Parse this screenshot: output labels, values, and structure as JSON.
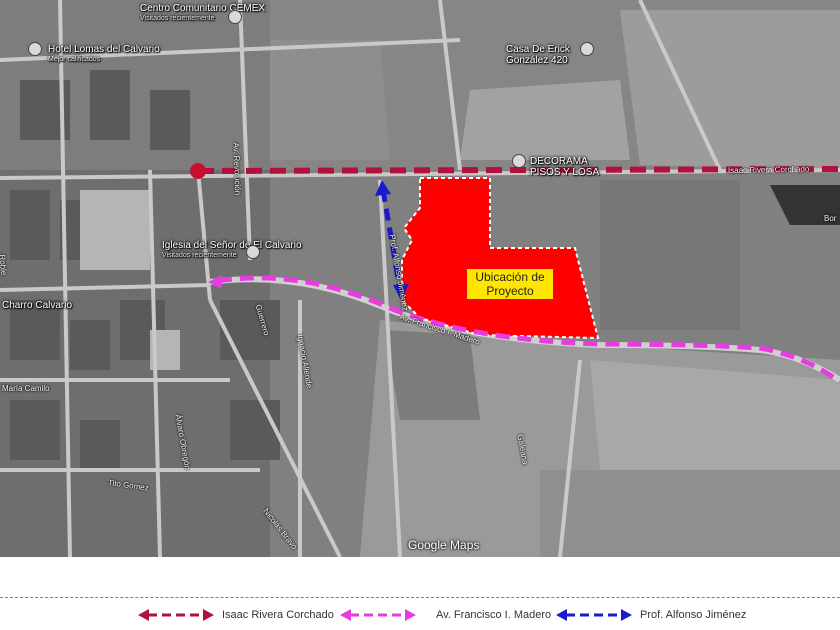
{
  "map": {
    "attribution": "Google Maps",
    "project_label": "Ubicación de Proyecto",
    "pois": [
      {
        "name": "Centro Comunitario CEMEX",
        "sub": "Visitados recientemente"
      },
      {
        "name": "Hotel Lomas del Calvario",
        "sub": "Mejor calificados"
      },
      {
        "name": "Casa De Erick González 420",
        "sub": ""
      },
      {
        "name": "DECORAMA PISOS Y LOSA",
        "sub": ""
      },
      {
        "name": "Iglesia del Señor de El Calvario",
        "sub": "Visitados recientemente"
      },
      {
        "name": "Charro Calvario",
        "sub": ""
      }
    ],
    "streets": [
      "Av. Revolución",
      "Isaac Rivera Corchado",
      "Prof. Alfonso Jiménez",
      "Av. Francisco I. Madero",
      "Nicolás Bravo",
      "Ignacio Allende",
      "Galeana",
      "Álvaro Obregón",
      "Guerrero",
      "María Camilo",
      "Tito Gómez",
      "Roble",
      "Bor"
    ],
    "colors": {
      "isaac": "#b0123b",
      "madero": "#e83be0",
      "alfonso": "#1a1ad0",
      "project": "#ff0000"
    }
  },
  "legend": {
    "items": [
      {
        "label": "Isaac Rivera Corchado",
        "color": "#b0123b",
        "icon": "double-arrow-icon"
      },
      {
        "label": "Av. Francisco I. Madero",
        "color": "#e83be0",
        "icon": "double-arrow-icon"
      },
      {
        "label": "Prof. Alfonso Jiménez",
        "color": "#1a1ad0",
        "icon": "double-arrow-icon"
      }
    ]
  }
}
